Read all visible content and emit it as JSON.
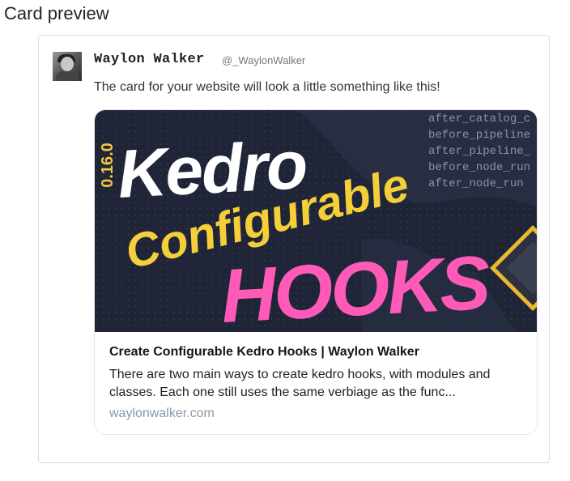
{
  "section": {
    "title": "Card preview"
  },
  "tweet": {
    "author_name": "Waylon Walker",
    "author_handle": "@_WaylonWalker",
    "text": "The card for your website will look a little something like this!"
  },
  "card": {
    "image": {
      "version": "0.16.0",
      "word1": "Kedro",
      "word2": "Configurable",
      "word3": "HOOKS",
      "code_lines": [
        "after_catalog_c",
        "before_pipeline",
        "after_pipeline_",
        "before_node_run",
        "after_node_run"
      ]
    },
    "title": "Create Configurable Kedro Hooks | Waylon Walker",
    "description": "There are two main ways to create kedro hooks, with modules and classes. Each one still uses the same verbiage as the func...",
    "domain": "waylonwalker.com"
  }
}
